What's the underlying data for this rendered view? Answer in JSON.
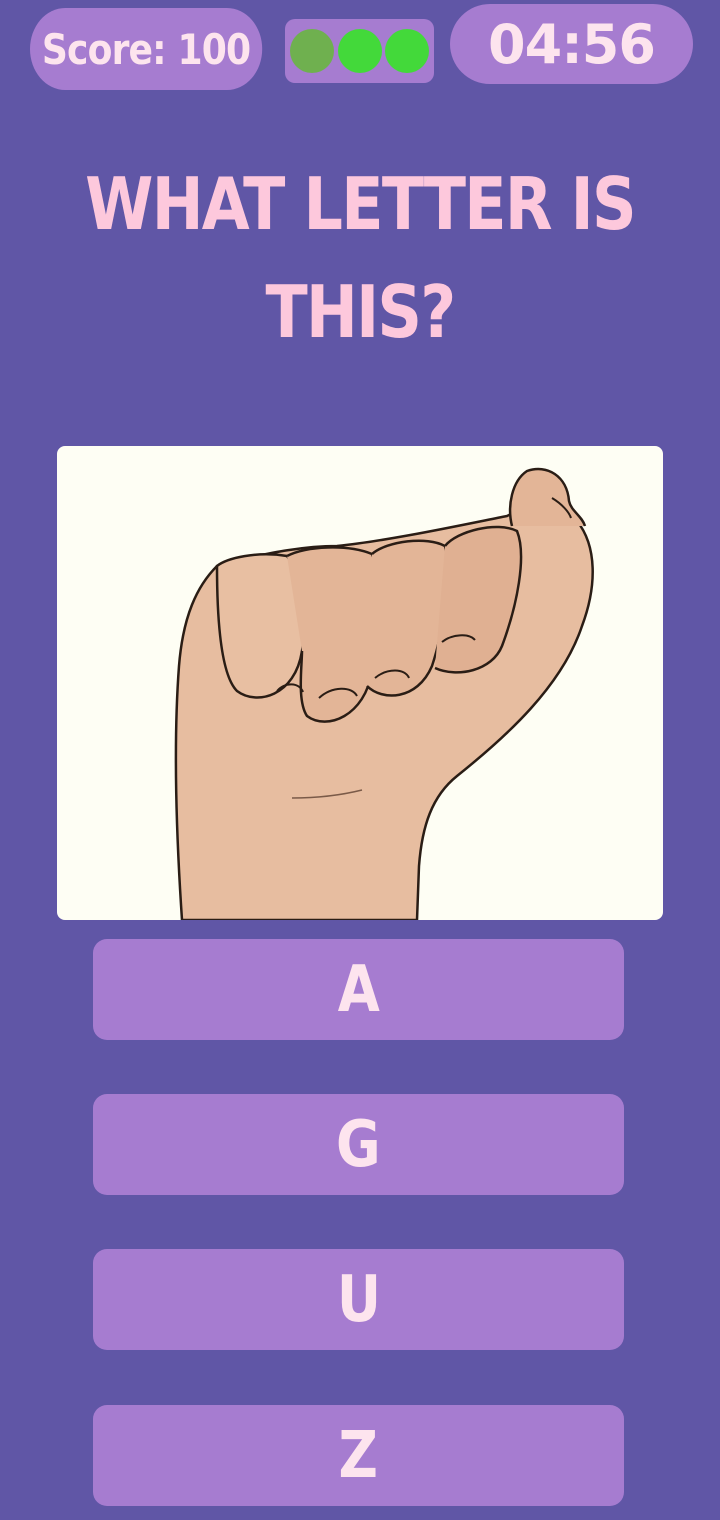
{
  "hud": {
    "score_text": "Score: 100",
    "timer": "04:56",
    "lives": [
      {
        "state": "used",
        "color": "#6fb04f"
      },
      {
        "state": "active",
        "color": "#43d93a"
      },
      {
        "state": "active",
        "color": "#43d93a"
      }
    ]
  },
  "question": {
    "text": "WHAT LETTER IS THIS?"
  },
  "image": {
    "icon": "hand-sign-icon"
  },
  "answers": [
    {
      "label": "A"
    },
    {
      "label": "G"
    },
    {
      "label": "U"
    },
    {
      "label": "Z"
    }
  ],
  "colors": {
    "background": "#6056a6",
    "panel": "#a67cd0",
    "title_text": "#fdc8dc",
    "button_text": "#fde4ee"
  }
}
